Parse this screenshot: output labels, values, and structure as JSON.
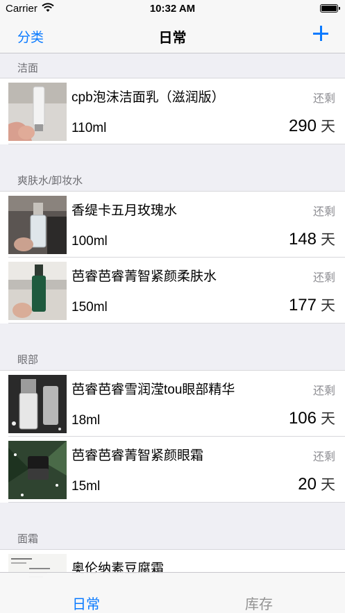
{
  "status_bar": {
    "carrier": "Carrier",
    "time": "10:32 AM"
  },
  "nav": {
    "left_label": "分类",
    "title": "日常",
    "add_icon": "plus-icon"
  },
  "remain_label": "还剩",
  "days_unit": "天",
  "sections": [
    {
      "header": "洁面",
      "items": [
        {
          "name": "cpb泡沫洁面乳（滋润版）",
          "volume": "110ml",
          "days": "290"
        }
      ]
    },
    {
      "header": "爽肤水/卸妆水",
      "items": [
        {
          "name": "香缇卡五月玫瑰水",
          "volume": "100ml",
          "days": "148"
        },
        {
          "name": "芭睿芭睿菁智紧颜柔肤水",
          "volume": "150ml",
          "days": "177"
        }
      ]
    },
    {
      "header": "眼部",
      "items": [
        {
          "name": "芭睿芭睿雪润滢tou眼部精华",
          "volume": "18ml",
          "days": "106"
        },
        {
          "name": "芭睿芭睿菁智紧颜眼霜",
          "volume": "15ml",
          "days": "20"
        }
      ]
    },
    {
      "header": "面霜",
      "items": [
        {
          "name": "奥伦纳素豆腐霜"
        }
      ]
    }
  ],
  "tabs": [
    {
      "label": "日常",
      "active": true
    },
    {
      "label": "库存",
      "active": false
    }
  ],
  "colors": {
    "accent": "#0a7aff",
    "background": "#efeff4",
    "secondary_text": "#8e8e93"
  }
}
